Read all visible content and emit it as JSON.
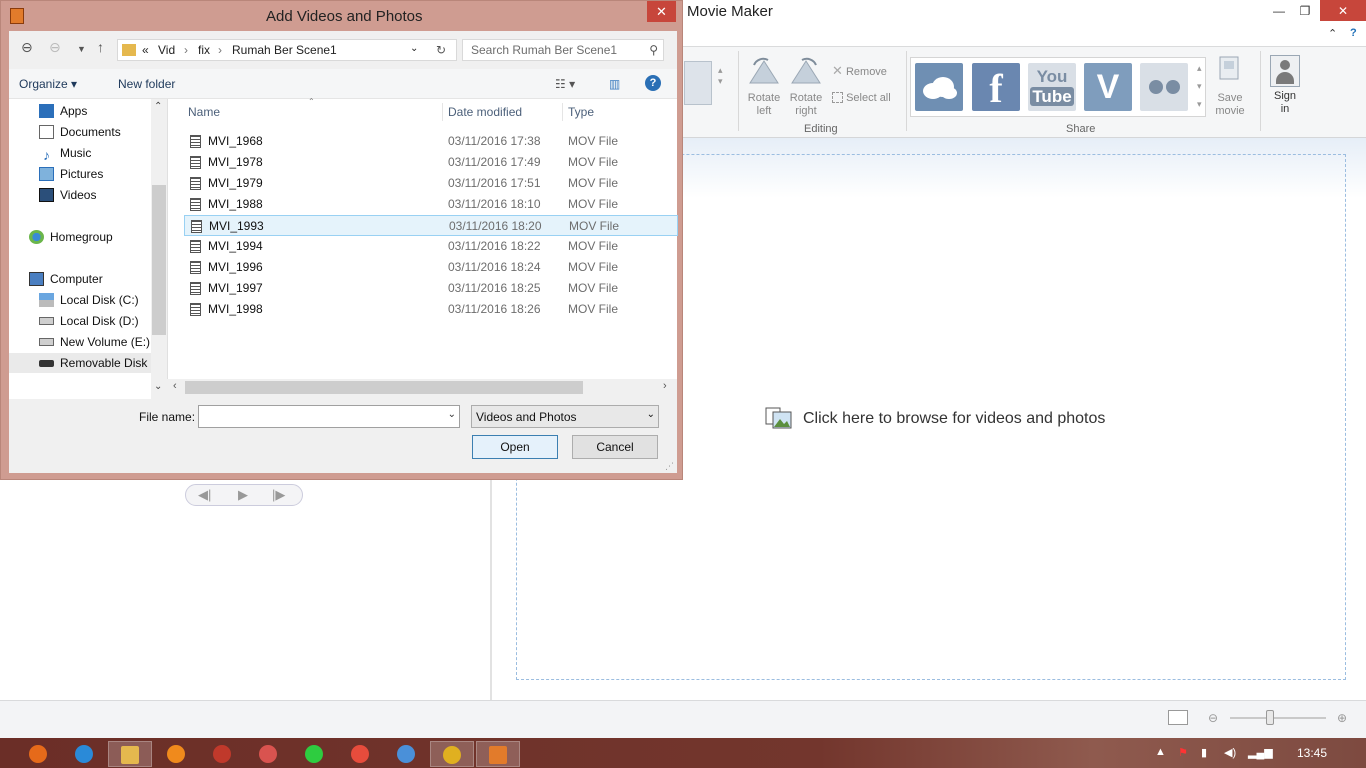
{
  "movie_maker": {
    "title": "Movie Maker",
    "ribbon": {
      "rotate_left": "Rotate left",
      "rotate_right": "Rotate right",
      "remove": "Remove",
      "select_all": "Select all",
      "editing_label": "Editing",
      "share_label": "Share",
      "save_movie": "Save movie",
      "sign_in": "Sign in",
      "share_services": [
        "onedrive",
        "facebook",
        "youtube",
        "vimeo",
        "flickr"
      ]
    },
    "browse_prompt": "Click here to browse for videos and photos"
  },
  "dialog": {
    "title": "Add Videos and Photos",
    "breadcrumb": [
      "«",
      "Vid",
      "fix",
      "Rumah Ber Scene1"
    ],
    "search_placeholder": "Search Rumah Ber Scene1",
    "toolbar": {
      "organize": "Organize",
      "new_folder": "New folder"
    },
    "nav_items": [
      {
        "label": "Apps",
        "icon": "apps-icon"
      },
      {
        "label": "Documents",
        "icon": "documents-icon"
      },
      {
        "label": "Music",
        "icon": "music-icon"
      },
      {
        "label": "Pictures",
        "icon": "pictures-icon"
      },
      {
        "label": "Videos",
        "icon": "videos-icon"
      },
      {
        "label": "Homegroup",
        "icon": "homegroup-icon"
      },
      {
        "label": "Computer",
        "icon": "computer-icon"
      },
      {
        "label": "Local Disk (C:)",
        "icon": "drive-icon"
      },
      {
        "label": "Local Disk (D:)",
        "icon": "drive-icon"
      },
      {
        "label": "New Volume (E:)",
        "icon": "drive-icon"
      },
      {
        "label": "Removable Disk (",
        "icon": "usb-drive-icon"
      }
    ],
    "columns": {
      "name": "Name",
      "date": "Date modified",
      "type": "Type"
    },
    "files": [
      {
        "name": "MVI_1968",
        "date": "03/11/2016 17:38",
        "type": "MOV File"
      },
      {
        "name": "MVI_1978",
        "date": "03/11/2016 17:49",
        "type": "MOV File"
      },
      {
        "name": "MVI_1979",
        "date": "03/11/2016 17:51",
        "type": "MOV File"
      },
      {
        "name": "MVI_1988",
        "date": "03/11/2016 18:10",
        "type": "MOV File"
      },
      {
        "name": "MVI_1993",
        "date": "03/11/2016 18:20",
        "type": "MOV File"
      },
      {
        "name": "MVI_1994",
        "date": "03/11/2016 18:22",
        "type": "MOV File"
      },
      {
        "name": "MVI_1996",
        "date": "03/11/2016 18:24",
        "type": "MOV File"
      },
      {
        "name": "MVI_1997",
        "date": "03/11/2016 18:25",
        "type": "MOV File"
      },
      {
        "name": "MVI_1998",
        "date": "03/11/2016 18:26",
        "type": "MOV File"
      }
    ],
    "selected_file": "MVI_1993",
    "file_name_label": "File name:",
    "file_name_value": "",
    "file_type": "Videos and Photos",
    "open_label": "Open",
    "cancel_label": "Cancel"
  },
  "taskbar": {
    "apps": [
      "firefox",
      "internet-explorer",
      "file-explorer",
      "avast",
      "app-5",
      "app-6",
      "line",
      "app-8",
      "chrome-remote",
      "chrome",
      "movie-maker"
    ],
    "clock": "13:45"
  }
}
